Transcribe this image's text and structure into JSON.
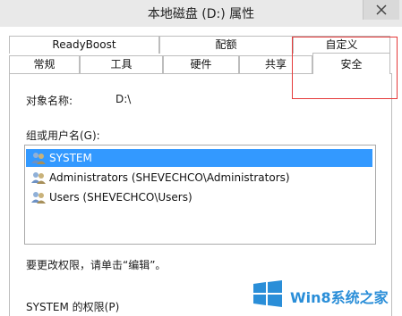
{
  "window": {
    "title": "本地磁盘 (D:) 属性"
  },
  "tabs_back": [
    "ReadyBoost",
    "配额",
    "自定义"
  ],
  "tabs_front": [
    "常规",
    "工具",
    "硬件",
    "共享",
    "安全"
  ],
  "object_name": {
    "label": "对象名称:",
    "value": "D:\\"
  },
  "groups": {
    "label": "组或用户名(G):",
    "items": [
      {
        "name": "SYSTEM",
        "selected": true
      },
      {
        "name": "Administrators (SHEVECHCO\\Administrators)",
        "selected": false
      },
      {
        "name": "Users (SHEVECHCO\\Users)",
        "selected": false
      }
    ]
  },
  "edit_hint": "要更改权限，请单击“编辑”。",
  "permissions_label": "SYSTEM 的权限(P)",
  "watermark": {
    "text": "Win8系统之家"
  },
  "colors": {
    "selection": "#3399ff",
    "highlight_box": "#e53a3a",
    "watermark": "#2a8ed8"
  }
}
